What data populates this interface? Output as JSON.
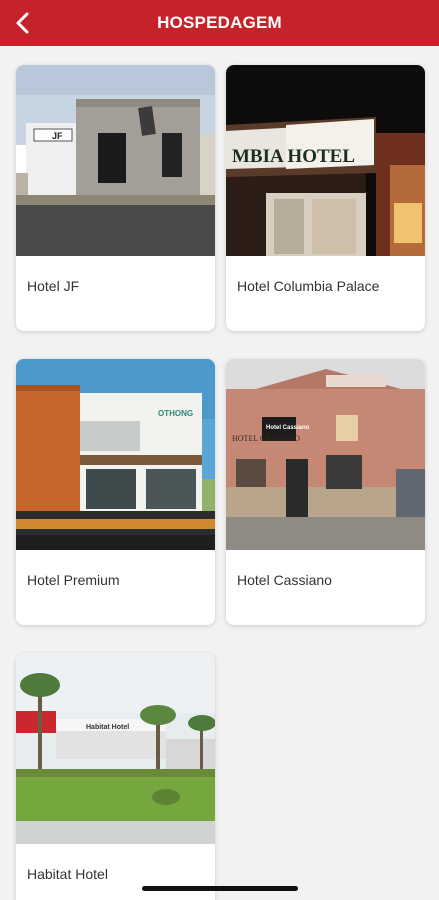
{
  "header": {
    "title": "HOSPEDAGEM",
    "back_icon": "chevron-left-icon",
    "bar_color": "#c62229"
  },
  "hotels": [
    {
      "name": "Hotel JF",
      "image": "hotel-jf-photo"
    },
    {
      "name": "Hotel Columbia Palace",
      "image": "hotel-columbia-palace-photo"
    },
    {
      "name": "Hotel Premium",
      "image": "hotel-premium-photo"
    },
    {
      "name": "Hotel Cassiano",
      "image": "hotel-cassiano-photo"
    },
    {
      "name": "Habitat Hotel",
      "image": "habitat-hotel-photo"
    }
  ],
  "photo_signage": {
    "jf": "JF",
    "columbia": "MBIA HOTEL",
    "premium": "OTHONG",
    "cassiano_sign": "Hotel Cassiano",
    "cassiano_wall": "HOTEL CASSIANO",
    "habitat": "Habitat Hotel"
  }
}
